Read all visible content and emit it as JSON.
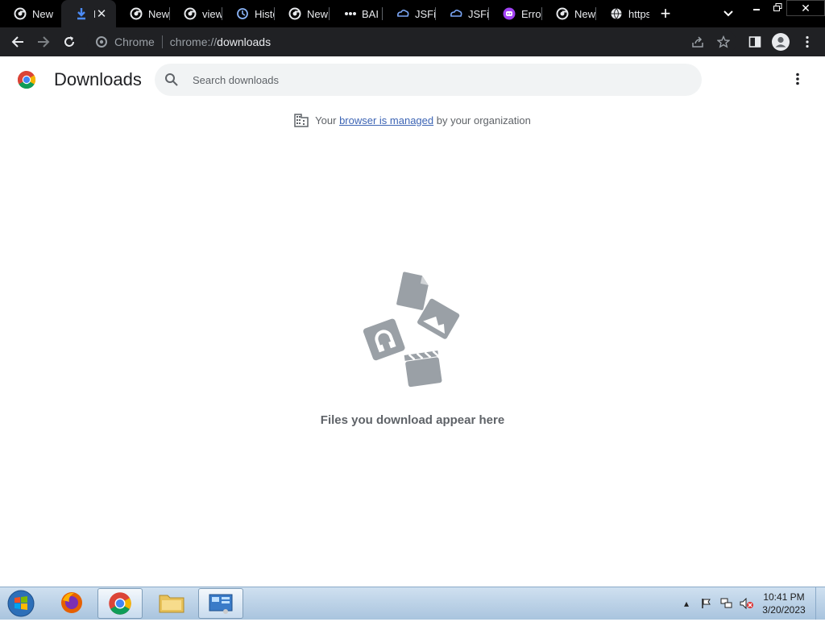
{
  "tabs": [
    {
      "title": "New",
      "icon": "chrome-icon",
      "active": false
    },
    {
      "title": "D",
      "icon": "download-icon",
      "active": true
    },
    {
      "title": "New",
      "icon": "chrome-icon",
      "active": false
    },
    {
      "title": "view-",
      "icon": "chrome-icon",
      "active": false
    },
    {
      "title": "Histo",
      "icon": "history-icon",
      "active": false
    },
    {
      "title": "New",
      "icon": "chrome-icon",
      "active": false
    },
    {
      "title": "BAI C",
      "icon": "bai-icon",
      "active": false
    },
    {
      "title": "JSFid",
      "icon": "jsfiddle-icon",
      "active": false
    },
    {
      "title": "JSFid",
      "icon": "jsfiddle-icon",
      "active": false
    },
    {
      "title": "Error",
      "icon": "bot-icon",
      "active": false
    },
    {
      "title": "New",
      "icon": "chrome-icon",
      "active": false
    },
    {
      "title": "https",
      "icon": "globe-icon",
      "active": false
    }
  ],
  "omnibox": {
    "chip": "Chrome",
    "url_prefix": "chrome://",
    "url_host": "downloads"
  },
  "page": {
    "title": "Downloads",
    "search_placeholder": "Search downloads",
    "managed_prefix": "Your",
    "managed_link": "browser is managed",
    "managed_suffix": "by your organization",
    "empty_text": "Files you download appear here"
  },
  "taskbar": {
    "time": "10:41 PM",
    "date": "3/20/2023"
  },
  "colors": {
    "tabstrip": "#000000",
    "toolbar": "#202124",
    "link": "#3c64b4",
    "illustration": "#9aa0a6"
  }
}
